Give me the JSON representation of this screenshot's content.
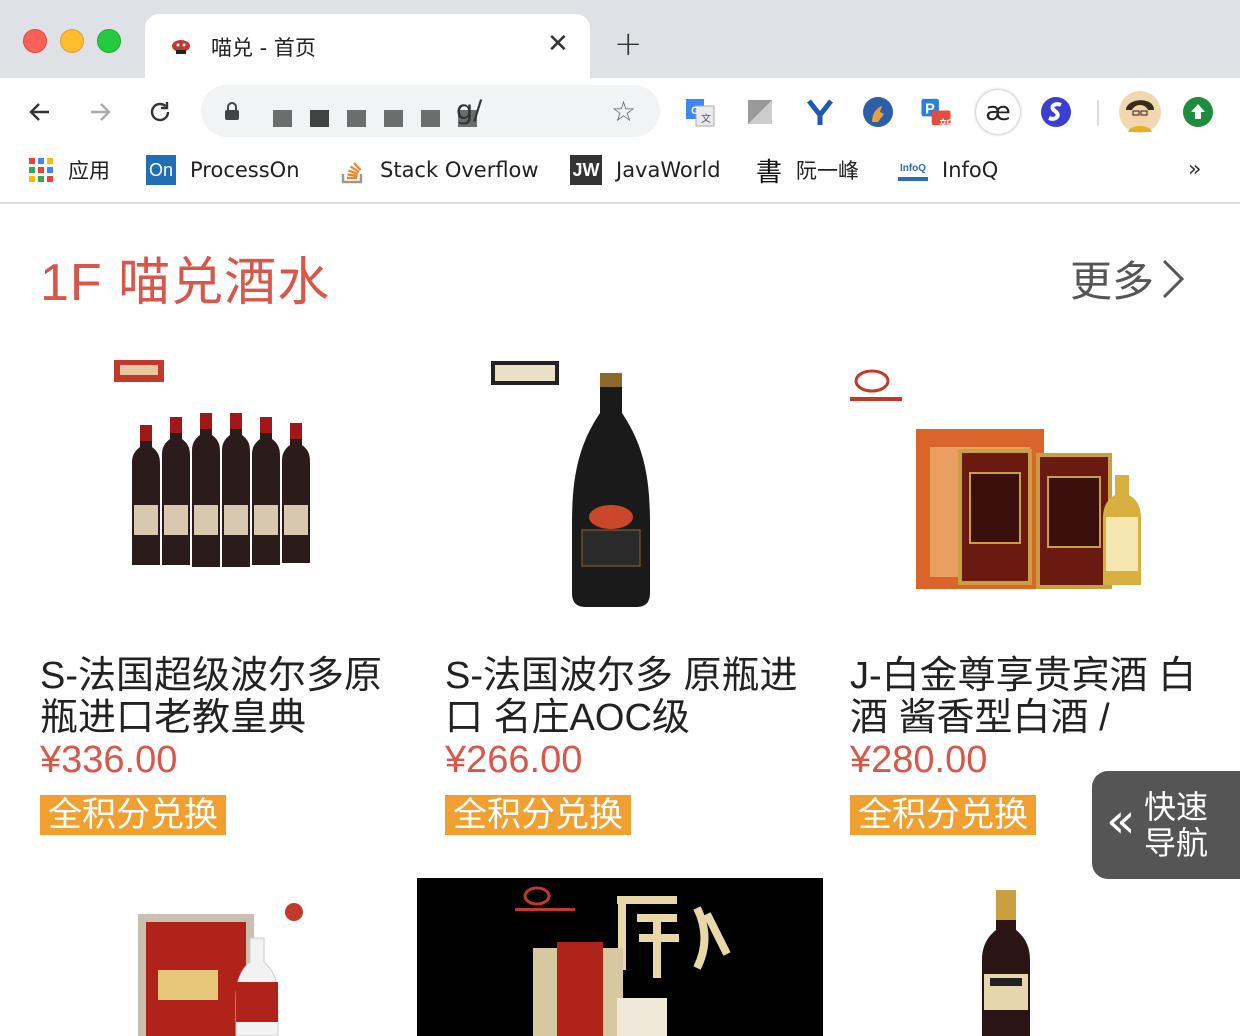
{
  "browser": {
    "tab_title": "喵兑 - 首页",
    "tab_close": "✕",
    "new_tab": "+",
    "url_suffix": "g/",
    "star": "☆",
    "bookmarks": [
      {
        "label": "应用",
        "icon": "apps-grid-icon"
      },
      {
        "label": "ProcessOn",
        "icon": "processon-icon"
      },
      {
        "label": "Stack Overflow",
        "icon": "stackoverflow-icon"
      },
      {
        "label": "JavaWorld",
        "icon": "javaworld-icon"
      },
      {
        "label": "阮一峰",
        "icon": "shu-calligraphy-icon"
      },
      {
        "label": "InfoQ",
        "icon": "infoq-icon"
      }
    ],
    "bookmarks_more": "»",
    "extension_badge": "新",
    "ae_label": "æ"
  },
  "floor": {
    "title": "1F 喵兑酒水",
    "more_label": "更多"
  },
  "products": [
    {
      "name": "S-法国超级波尔多原瓶进口老教皇典",
      "price": "¥336.00",
      "tag": "全积分兑换"
    },
    {
      "name": "S-法国波尔多 原瓶进口 名庄AOC级",
      "price": "¥266.00",
      "tag": "全积分兑换"
    },
    {
      "name": "J-白金尊享贵宾酒 白酒 酱香型白酒 /",
      "price": "¥280.00",
      "tag": "全积分兑换"
    }
  ],
  "quick_nav": {
    "chevron": "«",
    "label": "快速导航"
  },
  "colors": {
    "accent_red": "#d9564a",
    "tag_orange": "#f0a030",
    "quick_nav_bg": "#555555"
  }
}
